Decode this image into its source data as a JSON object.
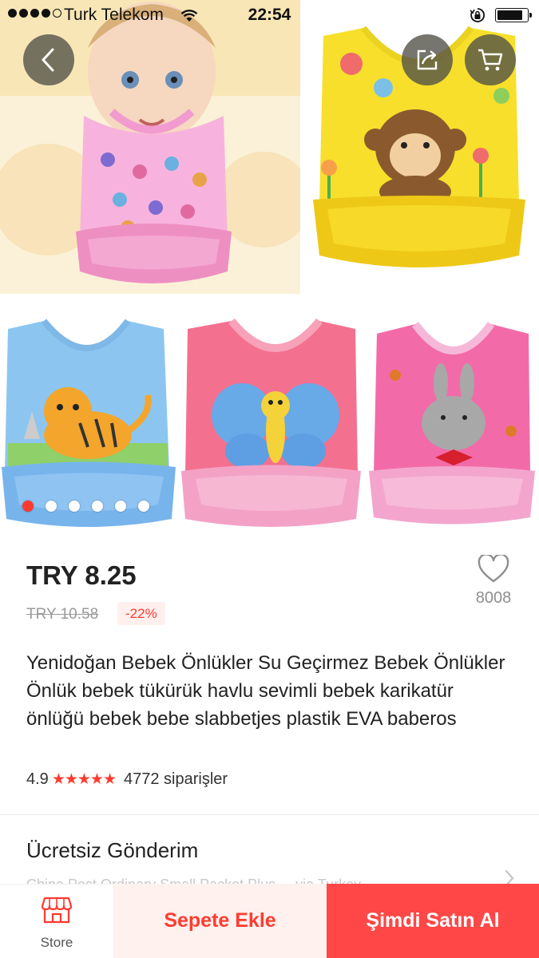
{
  "status_bar": {
    "carrier": "Turk Telekom",
    "time": "22:54",
    "signal_bars": 4,
    "battery_level": 0.85
  },
  "gallery": {
    "images": [
      "baby-pink-bib",
      "yellow-monkey-bib",
      "blue-tiger-bib",
      "pink-butterfly-bib",
      "pink-bunny-bib"
    ],
    "image_count": 6,
    "active_index": 0,
    "icons": {
      "back": "chevron-left-icon",
      "share": "share-icon",
      "cart": "cart-icon"
    }
  },
  "price": {
    "current": "TRY 8.25",
    "original": "TRY 10.58",
    "discount": "-22%"
  },
  "wishlist": {
    "icon": "heart-outline-icon",
    "count": "8008"
  },
  "product": {
    "title": "Yenidoğan Bebek Önlükler Su Geçirmez Bebek Önlükler Önlük bebek tükürük havlu sevimli bebek karikatür önlüğü bebek bebe slabbetjes plastik EVA baberos",
    "rating": "4.9",
    "stars": "★★★★★",
    "orders": "4772 siparişler"
  },
  "shipping": {
    "title": "Ücretsiz Gönderim",
    "subtitle": "China Post Ordinary Small Packet Plus ... via Turkey"
  },
  "bottom_bar": {
    "store_label": "Store",
    "add_to_cart": "Sepete Ekle",
    "buy_now": "Şimdi Satın Al"
  },
  "colors": {
    "accent": "#ff4747",
    "accent_text": "#ff3b30",
    "accent_light": "#fff1ee"
  }
}
